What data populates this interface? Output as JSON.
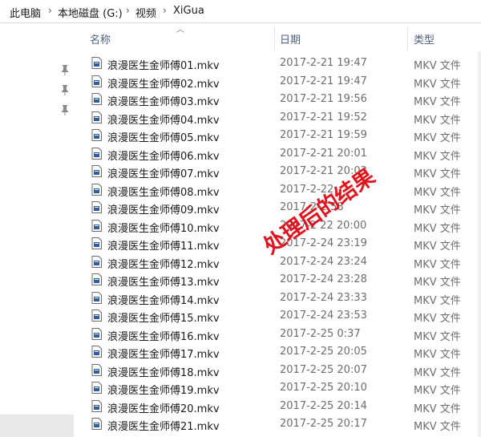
{
  "breadcrumb": [
    "此电脑",
    "本地磁盘 (G:)",
    "视频",
    "XiGua"
  ],
  "columns": {
    "name": "名称",
    "date": "日期",
    "type": "类型"
  },
  "files": [
    {
      "name": "浪漫医生金师傅01.mkv",
      "date": "2017-2-21 19:47",
      "type": "MKV 文件"
    },
    {
      "name": "浪漫医生金师傅02.mkv",
      "date": "2017-2-21 19:47",
      "type": "MKV 文件"
    },
    {
      "name": "浪漫医生金师傅03.mkv",
      "date": "2017-2-21 19:56",
      "type": "MKV 文件"
    },
    {
      "name": "浪漫医生金师傅04.mkv",
      "date": "2017-2-21 19:52",
      "type": "MKV 文件"
    },
    {
      "name": "浪漫医生金师傅05.mkv",
      "date": "2017-2-21 19:59",
      "type": "MKV 文件"
    },
    {
      "name": "浪漫医生金师傅06.mkv",
      "date": "2017-2-21 20:01",
      "type": "MKV 文件"
    },
    {
      "name": "浪漫医生金师傅07.mkv",
      "date": "2017-2-21 20:03",
      "type": "MKV 文件"
    },
    {
      "name": "浪漫医生金师傅08.mkv",
      "date": "2017-2-22",
      "type": "MKV 文件"
    },
    {
      "name": "浪漫医生金师傅09.mkv",
      "date": "2017-2-2 58",
      "type": "MKV 文件"
    },
    {
      "name": "浪漫医生金师傅10.mkv",
      "date": "2017-2 22 20:00",
      "type": "MKV 文件"
    },
    {
      "name": "浪漫医生金师傅11.mkv",
      "date": "2017-2-24 23:19",
      "type": "MKV 文件"
    },
    {
      "name": "浪漫医生金师傅12.mkv",
      "date": "2017-2-24 23:24",
      "type": "MKV 文件"
    },
    {
      "name": "浪漫医生金师傅13.mkv",
      "date": "2017-2-24 23:28",
      "type": "MKV 文件"
    },
    {
      "name": "浪漫医生金师傅14.mkv",
      "date": "2017-2-24 23:33",
      "type": "MKV 文件"
    },
    {
      "name": "浪漫医生金师傅15.mkv",
      "date": "2017-2-24 23:53",
      "type": "MKV 文件"
    },
    {
      "name": "浪漫医生金师傅16.mkv",
      "date": "2017-2-25 0:37",
      "type": "MKV 文件"
    },
    {
      "name": "浪漫医生金师傅17.mkv",
      "date": "2017-2-25 20:05",
      "type": "MKV 文件"
    },
    {
      "name": "浪漫医生金师傅18.mkv",
      "date": "2017-2-25 20:07",
      "type": "MKV 文件"
    },
    {
      "name": "浪漫医生金师傅19.mkv",
      "date": "2017-2-25 20:10",
      "type": "MKV 文件"
    },
    {
      "name": "浪漫医生金师傅20.mkv",
      "date": "2017-2-25 20:14",
      "type": "MKV 文件"
    },
    {
      "name": "浪漫医生金师傅21.mkv",
      "date": "2017-2-25 20:17",
      "type": "MKV 文件"
    }
  ],
  "overlay": {
    "text": "处理后的结果",
    "color": "#e0141e"
  },
  "colors": {
    "header_text": "#4d6082",
    "file_icon": "#2a5caa"
  },
  "nav_pins": [
    "pin-icon",
    "pin-icon",
    "pin-icon"
  ]
}
